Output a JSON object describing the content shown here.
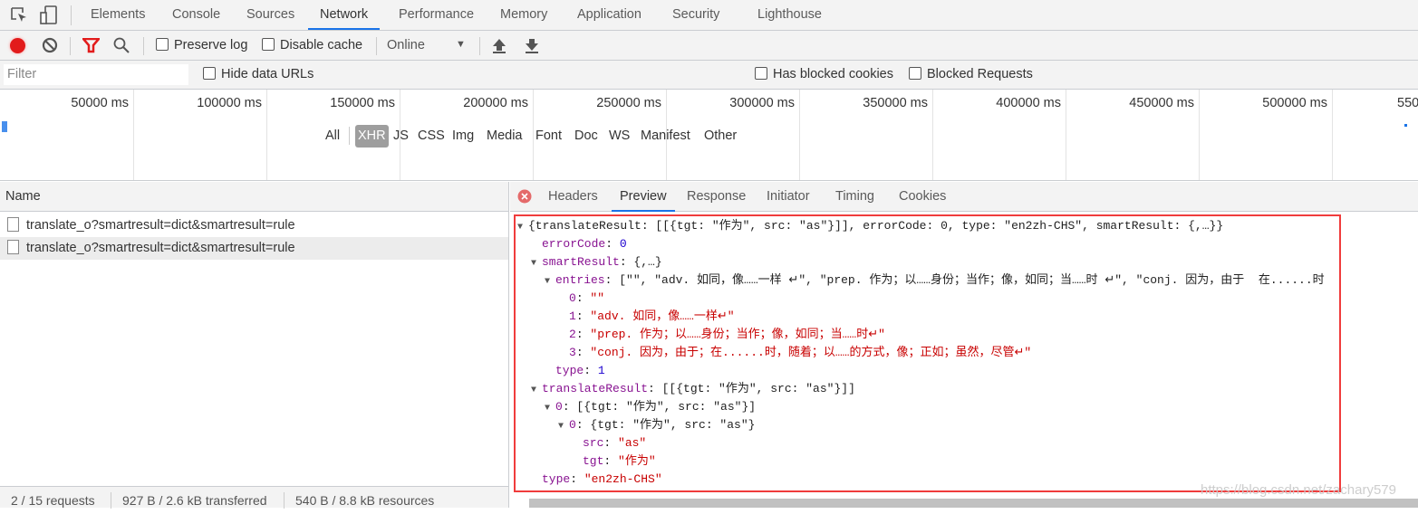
{
  "tabs": [
    "Elements",
    "Console",
    "Sources",
    "Network",
    "Performance",
    "Memory",
    "Application",
    "Security",
    "Lighthouse"
  ],
  "active_tab": "Network",
  "toolbar": {
    "preserve_log": "Preserve log",
    "disable_cache": "Disable cache",
    "throttle": "Online"
  },
  "filter": {
    "placeholder": "Filter",
    "hide_data_urls": "Hide data URLs",
    "types": [
      "All",
      "XHR",
      "JS",
      "CSS",
      "Img",
      "Media",
      "Font",
      "Doc",
      "WS",
      "Manifest",
      "Other"
    ],
    "active_type": "XHR",
    "blocked_cookies": "Has blocked cookies",
    "blocked_requests": "Blocked Requests"
  },
  "timeline": [
    "50000 ms",
    "100000 ms",
    "150000 ms",
    "200000 ms",
    "250000 ms",
    "300000 ms",
    "350000 ms",
    "400000 ms",
    "450000 ms",
    "500000 ms",
    "550"
  ],
  "requests": {
    "header": "Name",
    "rows": [
      "translate_o?smartresult=dict&smartresult=rule",
      "translate_o?smartresult=dict&smartresult=rule"
    ]
  },
  "status": {
    "requests": "2 / 15 requests",
    "transferred": "927 B / 2.6 kB transferred",
    "resources": "540 B / 8.8 kB resources"
  },
  "detail_tabs": [
    "Headers",
    "Preview",
    "Response",
    "Initiator",
    "Timing",
    "Cookies"
  ],
  "active_detail_tab": "Preview",
  "colors": {
    "accent": "#1a73e8",
    "record": "#e21b1b",
    "highlight_box": "#f03c3c",
    "key": "#881391",
    "number": "#1c00cf",
    "string": "#c80000"
  },
  "preview": [
    {
      "i": 0,
      "t": true,
      "p": [
        [
          "p",
          "{translateResult: [[{tgt: \"作为\", src: \"as\"}]], errorCode: 0, type: \"en2zh-CHS\", smartResult: {,…}}"
        ]
      ]
    },
    {
      "i": 1,
      "t": false,
      "p": [
        [
          "k",
          "errorCode"
        ],
        [
          "p",
          ": "
        ],
        [
          "n",
          "0"
        ]
      ]
    },
    {
      "i": 1,
      "t": true,
      "p": [
        [
          "k",
          "smartResult"
        ],
        [
          "p",
          ": {,…}"
        ]
      ]
    },
    {
      "i": 2,
      "t": true,
      "p": [
        [
          "k",
          "entries"
        ],
        [
          "p",
          ": [\"\", \"adv. 如同，像……一样 ↵\", \"prep. 作为；以……身份；当作；像，如同；当……时 ↵\", \"conj. 因为，由于  在......时"
        ]
      ]
    },
    {
      "i": 3,
      "t": false,
      "p": [
        [
          "k",
          "0"
        ],
        [
          "p",
          ": "
        ],
        [
          "s",
          "\"\""
        ]
      ]
    },
    {
      "i": 3,
      "t": false,
      "p": [
        [
          "k",
          "1"
        ],
        [
          "p",
          ": "
        ],
        [
          "s",
          "\"adv. 如同，像……一样↵\""
        ]
      ]
    },
    {
      "i": 3,
      "t": false,
      "p": [
        [
          "k",
          "2"
        ],
        [
          "p",
          ": "
        ],
        [
          "s",
          "\"prep. 作为；以……身份；当作；像，如同；当……时↵\""
        ]
      ]
    },
    {
      "i": 3,
      "t": false,
      "p": [
        [
          "k",
          "3"
        ],
        [
          "p",
          ": "
        ],
        [
          "s",
          "\"conj. 因为，由于；在......时，随着；以……的方式，像；正如；虽然，尽管↵\""
        ]
      ]
    },
    {
      "i": 2,
      "t": false,
      "p": [
        [
          "k",
          "type"
        ],
        [
          "p",
          ": "
        ],
        [
          "n",
          "1"
        ]
      ]
    },
    {
      "i": 1,
      "t": true,
      "p": [
        [
          "k",
          "translateResult"
        ],
        [
          "p",
          ": [[{tgt: \"作为\", src: \"as\"}]]"
        ]
      ]
    },
    {
      "i": 2,
      "t": true,
      "p": [
        [
          "k",
          "0"
        ],
        [
          "p",
          ": [{tgt: \"作为\", src: \"as\"}]"
        ]
      ]
    },
    {
      "i": 3,
      "t": true,
      "p": [
        [
          "k",
          "0"
        ],
        [
          "p",
          ": {tgt: \"作为\", src: \"as\"}"
        ]
      ]
    },
    {
      "i": 4,
      "t": false,
      "p": [
        [
          "k",
          "src"
        ],
        [
          "p",
          ": "
        ],
        [
          "s",
          "\"as\""
        ]
      ]
    },
    {
      "i": 4,
      "t": false,
      "p": [
        [
          "k",
          "tgt"
        ],
        [
          "p",
          ": "
        ],
        [
          "s",
          "\"作为\""
        ]
      ]
    },
    {
      "i": 1,
      "t": false,
      "p": [
        [
          "k",
          "type"
        ],
        [
          "p",
          ": "
        ],
        [
          "s",
          "\"en2zh-CHS\""
        ]
      ]
    }
  ],
  "watermark": "https://blog.csdn.net/zachary579"
}
